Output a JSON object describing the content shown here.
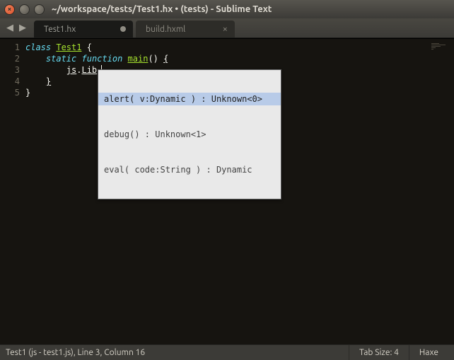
{
  "window": {
    "title": "~/workspace/tests/Test1.hx • (tests) - Sublime Text"
  },
  "tabs": [
    {
      "label": "Test1.hx",
      "dirty": true,
      "active": true
    },
    {
      "label": "build.hxml",
      "dirty": false,
      "active": false
    }
  ],
  "gutter": [
    "1",
    "2",
    "3",
    "4",
    "5"
  ],
  "code": {
    "l1_class": "class",
    "l1_name": "Test1",
    "l1_brace": " {",
    "l2_indent": "    ",
    "l2_static": "static",
    "l2_sp1": " ",
    "l2_function": "function",
    "l2_sp2": " ",
    "l2_main": "main",
    "l2_parens": "()",
    "l2_sp3": " ",
    "l2_brace": "{",
    "l3_indent": "        ",
    "l3_js": "js",
    "l3_dot1": ".",
    "l3_lib": "Lib",
    "l3_dot2": ".",
    "l4_indent": "    ",
    "l4_brace": "}",
    "l5_brace": "}"
  },
  "autocomplete": {
    "items": [
      "alert( v:Dynamic ) : Unknown<0>",
      "debug() : Unknown<1>",
      "eval( code:String ) : Dynamic"
    ]
  },
  "status": {
    "left": "Test1 (js - test1.js), Line 3, Column 16",
    "tab_size": "Tab Size: 4",
    "syntax": "Haxe"
  }
}
